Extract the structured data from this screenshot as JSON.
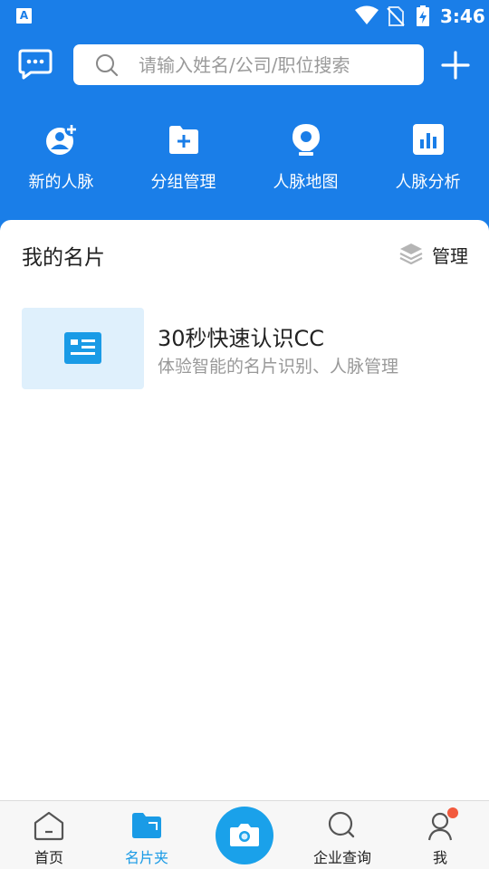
{
  "status_bar": {
    "time": "3:46",
    "app_indicator": "A",
    "icons": [
      "wifi-icon",
      "no-sim-icon",
      "battery-charging-icon"
    ]
  },
  "toolbar": {
    "search_placeholder": "请输入姓名/公司/职位搜索",
    "left_icon": "message-icon",
    "right_icon": "plus-icon"
  },
  "quick_actions": [
    {
      "label": "新的人脉",
      "icon": "add-contact-icon"
    },
    {
      "label": "分组管理",
      "icon": "folder-add-icon"
    },
    {
      "label": "人脉地图",
      "icon": "map-pin-icon"
    },
    {
      "label": "人脉分析",
      "icon": "bar-chart-icon"
    }
  ],
  "my_cards": {
    "title": "我的名片",
    "manage_label": "管理",
    "manage_icon": "layers-icon",
    "items": [
      {
        "title": "30秒快速认识CC",
        "subtitle": "体验智能的名片识别、人脉管理",
        "icon": "business-card-icon"
      }
    ]
  },
  "bottom_nav": {
    "tabs": [
      {
        "label": "首页",
        "icon": "home-icon",
        "active": false
      },
      {
        "label": "名片夹",
        "icon": "folder-icon",
        "active": true
      },
      {
        "label": "",
        "icon": "camera-icon",
        "active": false
      },
      {
        "label": "企业查询",
        "icon": "search-icon",
        "active": false
      },
      {
        "label": "我",
        "icon": "user-icon",
        "active": false,
        "badge": true
      }
    ]
  },
  "colors": {
    "brand_blue": "#1a7ee8",
    "accent_blue": "#1a9be6",
    "card_bg": "#dff0fc",
    "badge_red": "#f25a3e"
  }
}
